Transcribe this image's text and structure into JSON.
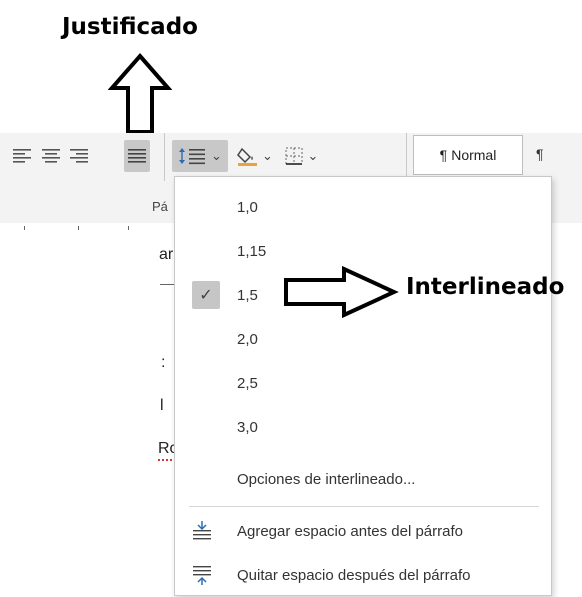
{
  "annotations": {
    "top_label": "Justificado",
    "right_label": "Interlineado"
  },
  "ribbon": {
    "alignment_buttons": [
      {
        "name": "align-left",
        "active": false
      },
      {
        "name": "align-center",
        "active": false
      },
      {
        "name": "align-right",
        "active": false
      },
      {
        "name": "justify",
        "active": true
      }
    ],
    "style_name": "Normal",
    "style_pilcrow": "¶",
    "after_pilcrow": "¶",
    "group_label": "Pá",
    "dropdown_glyph": "⌄"
  },
  "document_fragments": [
    "ar",
    ":",
    "l",
    "Ro"
  ],
  "menu": {
    "items": [
      "1,0",
      "1,15",
      "1,5",
      "2,0",
      "2,5",
      "3,0"
    ],
    "checked": "1,5",
    "check_glyph": "✓",
    "options_label": "Opciones de interlineado...",
    "add_space_label": "Agregar espacio antes del párrafo",
    "remove_space_label": "Quitar espacio después del párrafo"
  },
  "colors": {
    "ribbon_bg": "#f3f3f3",
    "active_button": "#c8c8c8",
    "icon_blue": "#2b6cb0",
    "paint_orange": "#e8a33a"
  }
}
